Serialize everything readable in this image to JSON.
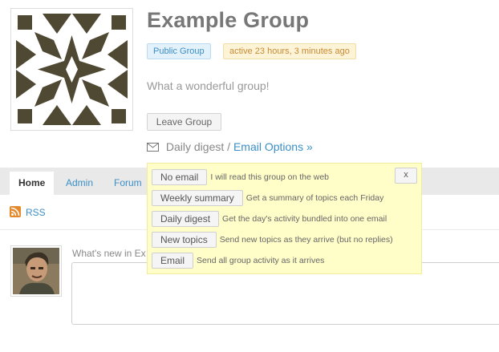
{
  "group": {
    "title": "Example Group",
    "status_badge": "Public Group",
    "activity_badge": "active 23 hours, 3 minutes ago",
    "description": "What a wonderful group!",
    "leave_label": "Leave Group"
  },
  "email": {
    "current_setting": "Daily digest",
    "separator": "/",
    "options_link": "Email Options »"
  },
  "tabs": [
    {
      "label": "Home"
    },
    {
      "label": "Admin"
    },
    {
      "label": "Forum"
    }
  ],
  "rss_label": "RSS",
  "activity": {
    "prompt": "What's new in Ex"
  },
  "email_popup": {
    "close_label": "x",
    "options": [
      {
        "label": "No email",
        "description": "I will read this group on the web"
      },
      {
        "label": "Weekly summary",
        "description": "Get a summary of topics each Friday"
      },
      {
        "label": "Daily digest",
        "description": "Get the day's activity bundled into one email"
      },
      {
        "label": "New topics",
        "description": "Send new topics as they arrive (but no replies)"
      },
      {
        "label": "Email",
        "description": "Send all group activity as it arrives"
      }
    ]
  },
  "colors": {
    "accent": "#3b8fc7",
    "popup_bg": "#fffdc8",
    "avatar_pattern": "#4f4833"
  }
}
